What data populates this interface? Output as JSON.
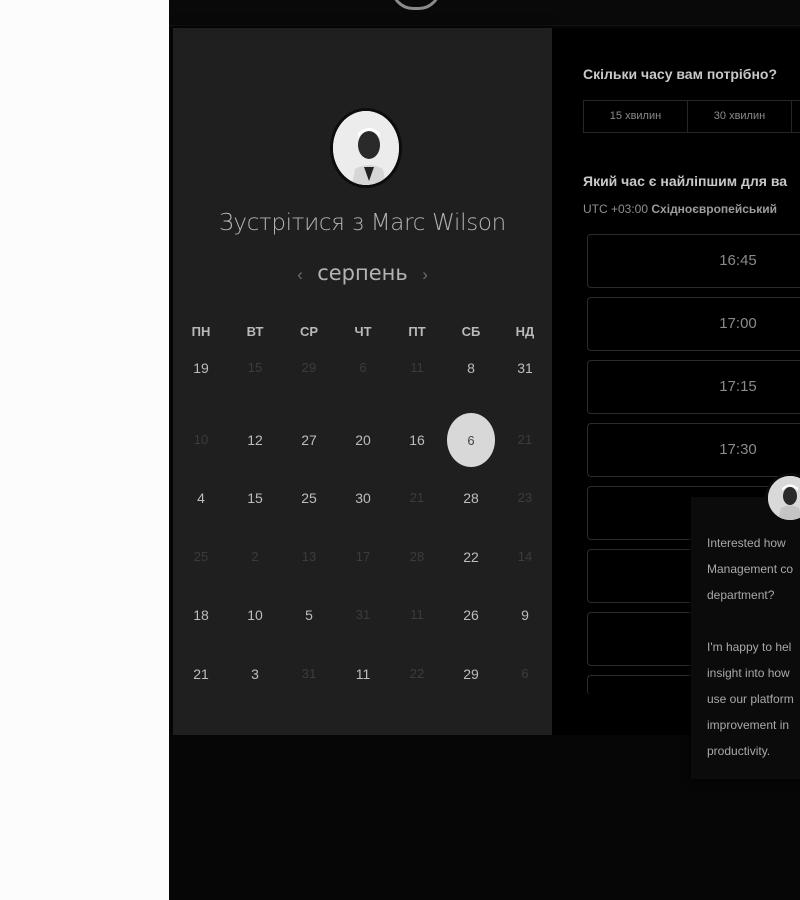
{
  "scheduler": {
    "meet_title": "Зустрітися з Marc Wilson",
    "month": "серпень",
    "prev_arrow": "‹",
    "next_arrow": "›",
    "weekdays": [
      "ПН",
      "ВТ",
      "СР",
      "ЧТ",
      "ПТ",
      "СБ",
      "НД"
    ],
    "weeks": [
      [
        {
          "d": "19",
          "dim": false
        },
        {
          "d": "15",
          "dim": true
        },
        {
          "d": "29",
          "dim": true
        },
        {
          "d": "6",
          "dim": true
        },
        {
          "d": "11",
          "dim": true
        },
        {
          "d": "8",
          "dim": false
        },
        {
          "d": "31",
          "dim": false
        }
      ],
      [
        {
          "d": "10",
          "dim": true
        },
        {
          "d": "12",
          "dim": false
        },
        {
          "d": "27",
          "dim": false
        },
        {
          "d": "20",
          "dim": false
        },
        {
          "d": "16",
          "dim": false
        },
        {
          "d": "6",
          "dim": false,
          "selected": true
        },
        {
          "d": "21",
          "dim": true
        }
      ],
      [
        {
          "d": "4",
          "dim": false
        },
        {
          "d": "15",
          "dim": false
        },
        {
          "d": "25",
          "dim": false
        },
        {
          "d": "30",
          "dim": false
        },
        {
          "d": "21",
          "dim": true
        },
        {
          "d": "28",
          "dim": false
        },
        {
          "d": "23",
          "dim": true
        }
      ],
      [
        {
          "d": "25",
          "dim": true
        },
        {
          "d": "2",
          "dim": true
        },
        {
          "d": "13",
          "dim": true
        },
        {
          "d": "17",
          "dim": true
        },
        {
          "d": "28",
          "dim": true
        },
        {
          "d": "22",
          "dim": false
        },
        {
          "d": "14",
          "dim": true
        }
      ],
      [
        {
          "d": "18",
          "dim": false
        },
        {
          "d": "10",
          "dim": false
        },
        {
          "d": "5",
          "dim": false
        },
        {
          "d": "31",
          "dim": true
        },
        {
          "d": "11",
          "dim": true
        },
        {
          "d": "26",
          "dim": false
        },
        {
          "d": "9",
          "dim": false
        }
      ],
      [
        {
          "d": "21",
          "dim": false
        },
        {
          "d": "3",
          "dim": false
        },
        {
          "d": "31",
          "dim": true
        },
        {
          "d": "11",
          "dim": false
        },
        {
          "d": "22",
          "dim": true
        },
        {
          "d": "29",
          "dim": false
        },
        {
          "d": "6",
          "dim": true
        }
      ]
    ]
  },
  "booking": {
    "duration_question": "Скільки часу вам потрібно?",
    "durations": [
      "15 хвилин",
      "30 хвилин",
      ""
    ],
    "time_question": "Який час є найліпшим для ва",
    "timezone_offset": "UTC +03:00",
    "timezone_name": "Східноєвропейський",
    "slots": [
      "16:45",
      "17:00",
      "17:15",
      "17:30",
      "",
      "",
      ""
    ]
  },
  "chat_popup": {
    "lines": [
      "Interested how",
      "Management co",
      "department?",
      "",
      "I'm happy to hel",
      "insight into how",
      "use our platform",
      "improvement in",
      "productivity."
    ]
  }
}
